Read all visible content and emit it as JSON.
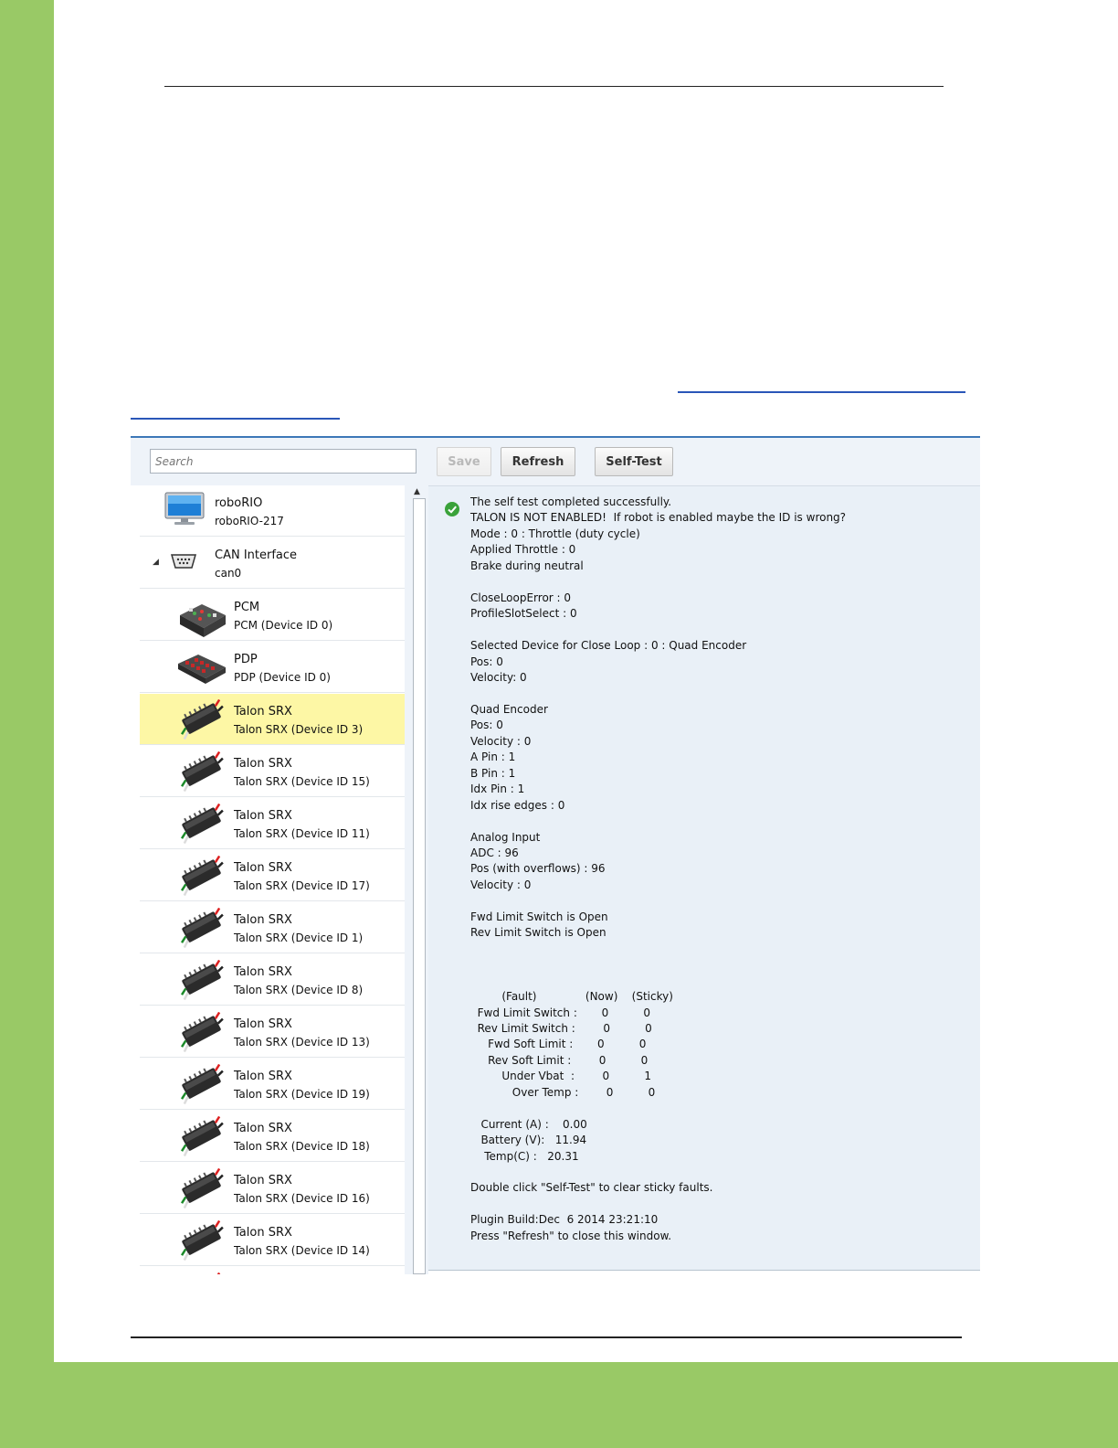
{
  "toolbar": {
    "search_placeholder": "Search",
    "save_label": "Save",
    "refresh_label": "Refresh",
    "selftest_label": "Self-Test"
  },
  "tree": {
    "roborio": {
      "name": "roboRIO",
      "sub": "roboRIO-217"
    },
    "can": {
      "name": "CAN Interface",
      "sub": "can0"
    },
    "devices": [
      {
        "name": "PCM",
        "sub": "PCM (Device ID 0)",
        "icon": "pcm-icon"
      },
      {
        "name": "PDP",
        "sub": "PDP (Device ID 0)",
        "icon": "pdp-icon"
      },
      {
        "name": "Talon SRX",
        "sub": "Talon SRX (Device ID 3)",
        "icon": "talon-srx-icon",
        "selected": true
      },
      {
        "name": "Talon SRX",
        "sub": "Talon SRX (Device ID 15)",
        "icon": "talon-srx-icon"
      },
      {
        "name": "Talon SRX",
        "sub": "Talon SRX (Device ID 11)",
        "icon": "talon-srx-icon"
      },
      {
        "name": "Talon SRX",
        "sub": "Talon SRX (Device ID 17)",
        "icon": "talon-srx-icon"
      },
      {
        "name": "Talon SRX",
        "sub": "Talon SRX (Device ID 1)",
        "icon": "talon-srx-icon"
      },
      {
        "name": "Talon SRX",
        "sub": "Talon SRX (Device ID 8)",
        "icon": "talon-srx-icon"
      },
      {
        "name": "Talon SRX",
        "sub": "Talon SRX (Device ID 13)",
        "icon": "talon-srx-icon"
      },
      {
        "name": "Talon SRX",
        "sub": "Talon SRX (Device ID 19)",
        "icon": "talon-srx-icon"
      },
      {
        "name": "Talon SRX",
        "sub": "Talon SRX (Device ID 18)",
        "icon": "talon-srx-icon"
      },
      {
        "name": "Talon SRX",
        "sub": "Talon SRX (Device ID 16)",
        "icon": "talon-srx-icon"
      },
      {
        "name": "Talon SRX",
        "sub": "Talon SRX (Device ID 14)",
        "icon": "talon-srx-icon"
      }
    ]
  },
  "details": {
    "status_icon": "success-check-icon",
    "log": "The self test completed successfully.\nTALON IS NOT ENABLED!  If robot is enabled maybe the ID is wrong?\nMode : 0 : Throttle (duty cycle)\nApplied Throttle : 0\nBrake during neutral\n\nCloseLoopError : 0\nProfileSlotSelect : 0\n\nSelected Device for Close Loop : 0 : Quad Encoder\nPos: 0\nVelocity: 0\n\nQuad Encoder\nPos: 0\nVelocity : 0\nA Pin : 1\nB Pin : 1\nIdx Pin : 1\nIdx rise edges : 0\n\nAnalog Input\nADC : 96\nPos (with overflows) : 96\nVelocity : 0\n\nFwd Limit Switch is Open\nRev Limit Switch is Open\n\n\n\n         (Fault)              (Now)    (Sticky)\n  Fwd Limit Switch :       0          0\n  Rev Limit Switch :        0          0\n     Fwd Soft Limit :       0          0\n     Rev Soft Limit :        0          0\n         Under Vbat  :        0          1\n            Over Temp :        0          0\n\n   Current (A) :    0.00\n   Battery (V):   11.94\n    Temp(C) :   20.31\n\nDouble click \"Self-Test\" to clear sticky faults.\n\nPlugin Build:Dec  6 2014 23:21:10\nPress \"Refresh\" to close this window."
  },
  "colors": {
    "page_green": "#99c966",
    "selection": "#fdf7a5",
    "panel_bg": "#e9f0f7",
    "link": "#2a56b8"
  }
}
